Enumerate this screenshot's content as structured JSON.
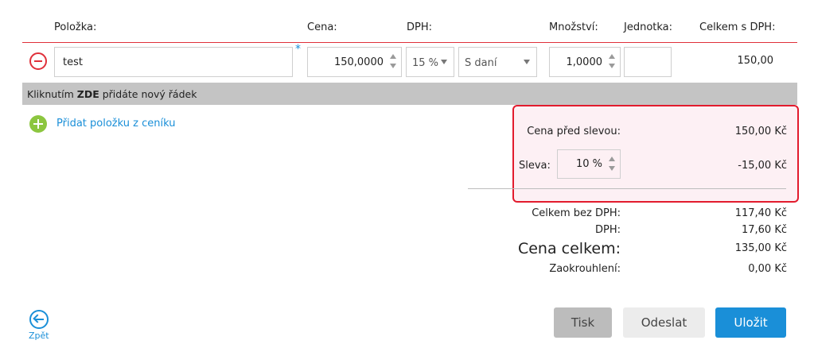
{
  "table": {
    "headers": {
      "item": "Položka:",
      "price": "Cena:",
      "vat": "DPH:",
      "quantity": "Množství:",
      "unit": "Jednotka:",
      "total_with_vat": "Celkem s DPH:"
    },
    "rows": [
      {
        "name": "test",
        "price": "150,0000",
        "vat_rate": "15 %",
        "vat_mode": "S daní",
        "quantity": "1,0000",
        "unit": "",
        "total": "150,00"
      }
    ],
    "required_mark": "*"
  },
  "add_row_bar": {
    "prefix": "Kliknutím",
    "bold": "ZDE",
    "suffix": "přidáte nový řádek"
  },
  "add_from_pricelist": "Přidat položku z ceníku",
  "discount": {
    "before_label": "Cena před slevou:",
    "before_value": "150,00 Kč",
    "discount_label": "Sleva:",
    "discount_rate": "10 %",
    "discount_value": "-15,00 Kč"
  },
  "summary": {
    "without_vat_label": "Celkem bez DPH:",
    "without_vat_value": "117,40 Kč",
    "vat_label": "DPH:",
    "vat_value": "17,60 Kč",
    "total_label": "Cena celkem:",
    "total_value": "135,00 Kč",
    "rounding_label": "Zaokrouhlení:",
    "rounding_value": "0,00 Kč"
  },
  "footer": {
    "back_label": "Zpět",
    "print_label": "Tisk",
    "send_label": "Odeslat",
    "save_label": "Uložit"
  },
  "colors": {
    "accent": "#1a8fd8",
    "danger": "#e0303a",
    "add": "#8cc63f",
    "highlight_border": "#e21b2d"
  },
  "icons": {
    "remove": "minus-circle-icon",
    "add": "plus-circle-icon",
    "back": "arrow-left-circle-icon",
    "spinner": "up-down-arrows-icon",
    "dropdown": "caret-down-icon"
  }
}
